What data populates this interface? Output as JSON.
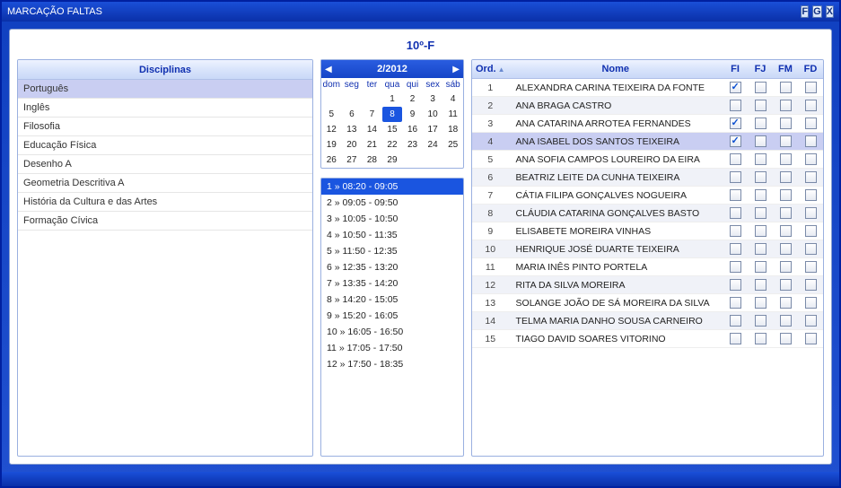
{
  "window": {
    "title": "MARCAÇÃO FALTAS"
  },
  "titlebar_buttons": [
    {
      "label": "F",
      "name": "btn-f"
    },
    {
      "label": "G",
      "name": "btn-g"
    },
    {
      "label": "X",
      "name": "btn-x"
    }
  ],
  "class_label": "10º-F",
  "disciplines_header": "Disciplinas",
  "disciplines": [
    {
      "label": "Português",
      "selected": true
    },
    {
      "label": "Inglês"
    },
    {
      "label": "Filosofia"
    },
    {
      "label": "Educação Física"
    },
    {
      "label": "Desenho A"
    },
    {
      "label": "Geometria Descritiva A"
    },
    {
      "label": "História da Cultura e das Artes"
    },
    {
      "label": "Formação Cívica"
    }
  ],
  "calendar": {
    "title": "2/2012",
    "dow": [
      "dom",
      "seg",
      "ter",
      "qua",
      "qui",
      "sex",
      "sáb"
    ],
    "weeks": [
      [
        "",
        "",
        "",
        "1",
        "2",
        "3",
        "4"
      ],
      [
        "5",
        "6",
        "7",
        "8",
        "9",
        "10",
        "11"
      ],
      [
        "12",
        "13",
        "14",
        "15",
        "16",
        "17",
        "18"
      ],
      [
        "19",
        "20",
        "21",
        "22",
        "23",
        "24",
        "25"
      ],
      [
        "26",
        "27",
        "28",
        "29",
        "",
        "",
        ""
      ]
    ],
    "selected": "8"
  },
  "slots": [
    {
      "label": "1 » 08:20 - 09:05",
      "selected": true
    },
    {
      "label": "2 » 09:05 - 09:50"
    },
    {
      "label": "3 » 10:05 - 10:50"
    },
    {
      "label": "4 » 10:50 - 11:35"
    },
    {
      "label": "5 » 11:50 - 12:35"
    },
    {
      "label": "6 » 12:35 - 13:20"
    },
    {
      "label": "7 » 13:35 - 14:20"
    },
    {
      "label": "8 » 14:20 - 15:05"
    },
    {
      "label": "9 » 15:20 - 16:05"
    },
    {
      "label": "10 » 16:05 - 16:50"
    },
    {
      "label": "11 » 17:05 - 17:50"
    },
    {
      "label": "12 » 17:50 - 18:35"
    }
  ],
  "students_header": {
    "ord": "Ord.",
    "name": "Nome",
    "fi": "FI",
    "fj": "FJ",
    "fm": "FM",
    "fd": "FD"
  },
  "students": [
    {
      "ord": 1,
      "name": "ALEXANDRA CARINA TEIXEIRA DA FONTE",
      "fi": true
    },
    {
      "ord": 2,
      "name": "ANA BRAGA CASTRO"
    },
    {
      "ord": 3,
      "name": "ANA CATARINA ARROTEA FERNANDES",
      "fi": true
    },
    {
      "ord": 4,
      "name": "ANA ISABEL DOS SANTOS TEIXEIRA",
      "fi": true,
      "highlight": true
    },
    {
      "ord": 5,
      "name": "ANA SOFIA CAMPOS LOUREIRO DA EIRA"
    },
    {
      "ord": 6,
      "name": "BEATRIZ LEITE DA CUNHA TEIXEIRA"
    },
    {
      "ord": 7,
      "name": "CÁTIA FILIPA GONÇALVES NOGUEIRA"
    },
    {
      "ord": 8,
      "name": "CLÁUDIA CATARINA GONÇALVES BASTO"
    },
    {
      "ord": 9,
      "name": "ELISABETE MOREIRA VINHAS"
    },
    {
      "ord": 10,
      "name": "HENRIQUE JOSÉ DUARTE TEIXEIRA"
    },
    {
      "ord": 11,
      "name": "MARIA INÊS PINTO PORTELA"
    },
    {
      "ord": 12,
      "name": "RITA DA SILVA MOREIRA"
    },
    {
      "ord": 13,
      "name": "SOLANGE JOÃO DE SÁ MOREIRA DA SILVA"
    },
    {
      "ord": 14,
      "name": "TELMA MARIA DANHO SOUSA CARNEIRO"
    },
    {
      "ord": 15,
      "name": "TIAGO DAVID SOARES VITORINO"
    }
  ]
}
